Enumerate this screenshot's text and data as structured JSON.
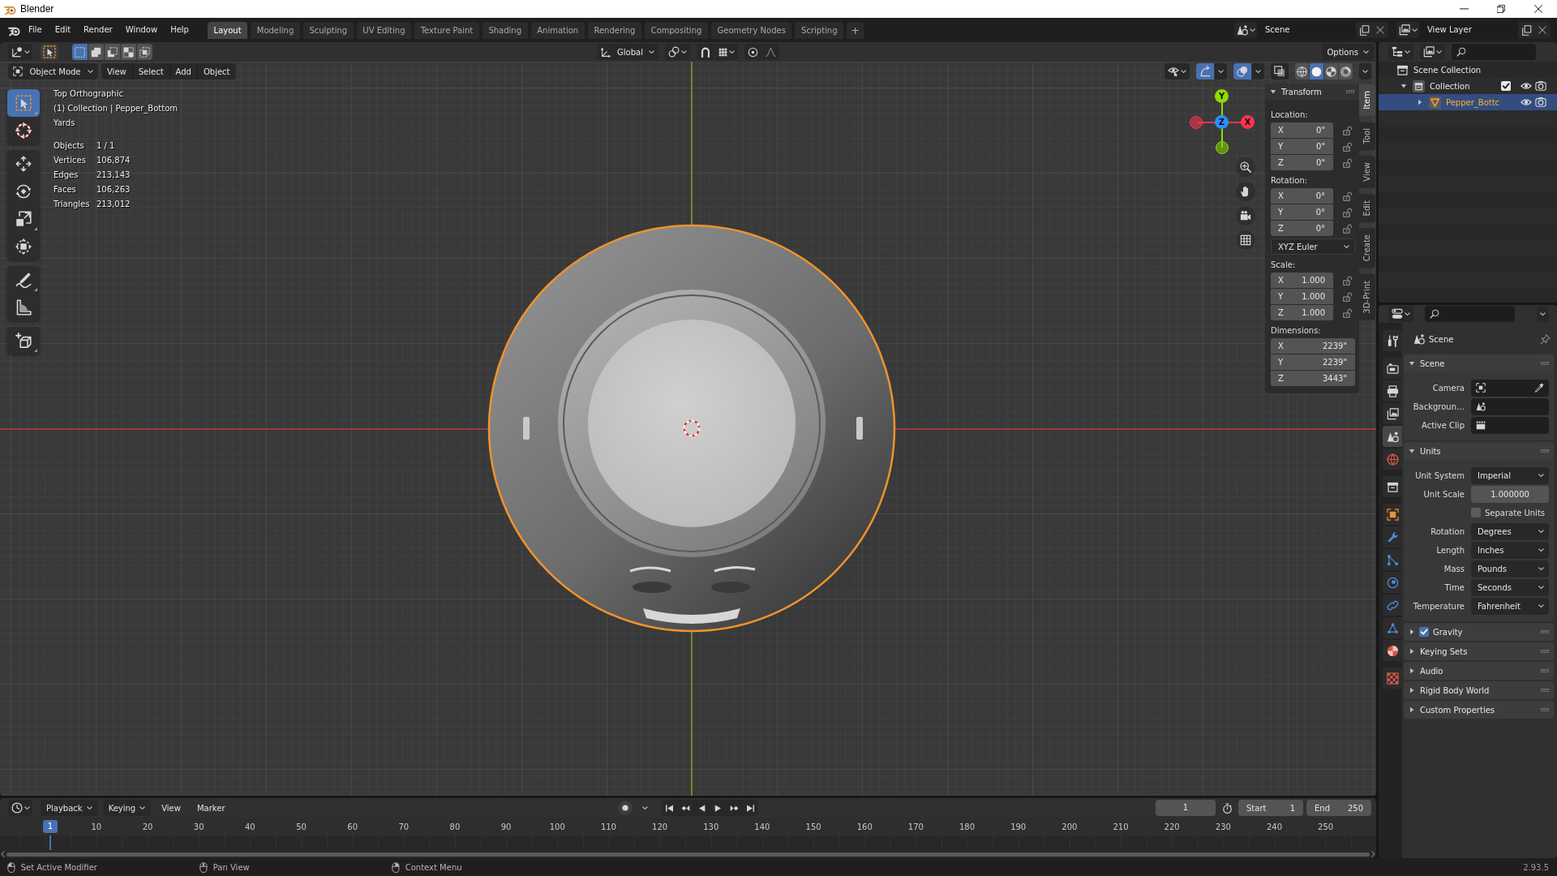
{
  "window": {
    "title": "Blender"
  },
  "top_bar": {
    "menus": [
      "File",
      "Edit",
      "Render",
      "Window",
      "Help"
    ],
    "workspace_tabs": [
      {
        "label": "Layout",
        "selected": true
      },
      {
        "label": "Modeling",
        "selected": false
      },
      {
        "label": "Sculpting",
        "selected": false
      },
      {
        "label": "UV Editing",
        "selected": false
      },
      {
        "label": "Texture Paint",
        "selected": false
      },
      {
        "label": "Shading",
        "selected": false
      },
      {
        "label": "Animation",
        "selected": false
      },
      {
        "label": "Rendering",
        "selected": false
      },
      {
        "label": "Compositing",
        "selected": false
      },
      {
        "label": "Geometry Nodes",
        "selected": false
      },
      {
        "label": "Scripting",
        "selected": false
      }
    ],
    "add_tab": "+",
    "scene": "Scene",
    "view_layer": "View Layer"
  },
  "viewport": {
    "tool_header": {
      "select_modes": [
        {
          "kind": "set",
          "selected": true
        },
        {
          "kind": "extend",
          "selected": false
        },
        {
          "kind": "subtract",
          "selected": false
        },
        {
          "kind": "invert",
          "selected": false
        },
        {
          "kind": "intersect",
          "selected": false
        }
      ],
      "orientation": "Global",
      "options": "Options"
    },
    "header": {
      "mode": "Object Mode",
      "menus": [
        "View",
        "Select",
        "Add",
        "Object"
      ],
      "toggles": [
        {
          "kind": "gizmos",
          "on": true
        },
        {
          "kind": "overlays",
          "on": true
        },
        {
          "kind": "xray",
          "on": false
        }
      ],
      "shading": [
        {
          "kind": "wireframe",
          "selected": false
        },
        {
          "kind": "solid",
          "selected": true
        },
        {
          "kind": "material",
          "selected": false
        },
        {
          "kind": "rendered",
          "selected": false
        }
      ]
    },
    "tool_groups": [
      {
        "tools": [
          {
            "kind": "select_box",
            "selected": true,
            "expandable": true
          },
          {
            "kind": "cursor",
            "selected": false,
            "expandable": false
          }
        ]
      },
      {
        "tools": [
          {
            "kind": "move",
            "selected": false,
            "expandable": false
          },
          {
            "kind": "rotate",
            "selected": false,
            "expandable": false
          },
          {
            "kind": "scale",
            "selected": false,
            "expandable": true
          },
          {
            "kind": "transform",
            "selected": false,
            "expandable": false
          }
        ]
      },
      {
        "tools": [
          {
            "kind": "annotate",
            "selected": false,
            "expandable": true
          },
          {
            "kind": "measure",
            "selected": false,
            "expandable": false
          }
        ]
      },
      {
        "tools": [
          {
            "kind": "add_cube",
            "selected": false,
            "expandable": true
          }
        ]
      }
    ],
    "info": {
      "lines": [
        "Top Orthographic",
        "(1) Collection | Pepper_Bottom",
        "Yards"
      ],
      "stats": [
        {
          "label": "Objects",
          "value": "1 / 1"
        },
        {
          "label": "Vertices",
          "value": "106,874"
        },
        {
          "label": "Edges",
          "value": "213,143"
        },
        {
          "label": "Faces",
          "value": "106,263"
        },
        {
          "label": "Triangles",
          "value": "213,012"
        }
      ]
    },
    "gizmo_axes": [
      {
        "label": "Y",
        "color": "#8bdc00"
      },
      {
        "label": "Z",
        "color": "#2890ff"
      },
      {
        "label": "X",
        "color": "#ff3352"
      }
    ],
    "sidebar": {
      "tabs": [
        {
          "label": "Item",
          "selected": true
        },
        {
          "label": "Tool",
          "selected": false
        },
        {
          "label": "View",
          "selected": false
        },
        {
          "label": "Edit",
          "selected": false
        },
        {
          "label": "Create",
          "selected": false
        },
        {
          "label": "3D-Print",
          "selected": false
        }
      ],
      "panel": {
        "title": "Transform",
        "expanded": true,
        "groups": [
          {
            "label": "Location:",
            "fields": [
              {
                "axis": "X",
                "value": "0\"",
                "locked": false
              },
              {
                "axis": "Y",
                "value": "0\"",
                "locked": false
              },
              {
                "axis": "Z",
                "value": "0\"",
                "locked": false
              }
            ]
          },
          {
            "label": "Rotation:",
            "fields": [
              {
                "axis": "X",
                "value": "0°",
                "locked": false
              },
              {
                "axis": "Y",
                "value": "0°",
                "locked": false
              },
              {
                "axis": "Z",
                "value": "0°",
                "locked": false
              }
            ],
            "mode": "XYZ Euler"
          },
          {
            "label": "Scale:",
            "fields": [
              {
                "axis": "X",
                "value": "1.000",
                "locked": false
              },
              {
                "axis": "Y",
                "value": "1.000",
                "locked": false
              },
              {
                "axis": "Z",
                "value": "1.000",
                "locked": false
              }
            ]
          },
          {
            "label": "Dimensions:",
            "fields": [
              {
                "axis": "X",
                "value": "2239\""
              },
              {
                "axis": "Y",
                "value": "2239\""
              },
              {
                "axis": "Z",
                "value": "3443\""
              }
            ]
          }
        ]
      }
    }
  },
  "outliner": {
    "tree": [
      {
        "label": "Scene Collection",
        "kind": "scene_collection",
        "selected": false,
        "children": [
          {
            "label": "Collection",
            "kind": "collection",
            "expanded": true,
            "checked": true,
            "selected": false,
            "children": [
              {
                "label": "Pepper_Bottc",
                "kind": "mesh_object",
                "expanded": false,
                "selected": true
              }
            ]
          }
        ]
      }
    ]
  },
  "properties": {
    "tab_groups": [
      {
        "tabs": [
          {
            "kind": "tool",
            "selected": false
          }
        ]
      },
      {
        "tabs": [
          {
            "kind": "render",
            "selected": false
          },
          {
            "kind": "output",
            "selected": false
          },
          {
            "kind": "view_layer",
            "selected": false
          },
          {
            "kind": "scene",
            "selected": true
          },
          {
            "kind": "world",
            "selected": false
          }
        ]
      },
      {
        "tabs": [
          {
            "kind": "collection",
            "selected": false
          }
        ]
      },
      {
        "tabs": [
          {
            "kind": "object",
            "selected": false
          },
          {
            "kind": "modifiers",
            "selected": false
          },
          {
            "kind": "particles",
            "selected": false
          },
          {
            "kind": "physics",
            "selected": false
          },
          {
            "kind": "constraints",
            "selected": false
          },
          {
            "kind": "data",
            "selected": false
          },
          {
            "kind": "material",
            "selected": false
          }
        ]
      },
      {
        "tabs": [
          {
            "kind": "texture",
            "selected": false
          }
        ]
      }
    ],
    "context": "Scene",
    "panels": [
      {
        "title": "Scene",
        "expanded": true,
        "rows": [
          {
            "kind": "camera_picker",
            "label": "Camera"
          },
          {
            "kind": "scene_picker",
            "label": "Backgroun…"
          },
          {
            "kind": "clip_picker",
            "label": "Active Clip"
          }
        ]
      },
      {
        "title": "Units",
        "expanded": true,
        "rows": [
          {
            "kind": "dropdown",
            "label": "Unit System",
            "value": "Imperial"
          },
          {
            "kind": "number",
            "label": "Unit Scale",
            "value": "1.000000"
          },
          {
            "kind": "checkbox",
            "label": "Separate Units",
            "checked": false
          },
          {
            "kind": "dropdown",
            "label": "Rotation",
            "value": "Degrees"
          },
          {
            "kind": "dropdown",
            "label": "Length",
            "value": "Inches"
          },
          {
            "kind": "dropdown",
            "label": "Mass",
            "value": "Pounds"
          },
          {
            "kind": "dropdown",
            "label": "Time",
            "value": "Seconds"
          },
          {
            "kind": "dropdown",
            "label": "Temperature",
            "value": "Fahrenheit"
          }
        ]
      },
      {
        "title": "Gravity",
        "expanded": false,
        "checked": true
      },
      {
        "title": "Keying Sets",
        "expanded": false
      },
      {
        "title": "Audio",
        "expanded": false
      },
      {
        "title": "Rigid Body World",
        "expanded": false
      },
      {
        "title": "Custom Properties",
        "expanded": false
      }
    ]
  },
  "timeline": {
    "menus": [
      {
        "label": "Playback",
        "dropdown": true
      },
      {
        "label": "Keying",
        "dropdown": true
      },
      {
        "label": "View",
        "dropdown": false
      },
      {
        "label": "Marker",
        "dropdown": false
      }
    ],
    "current_frame": "1",
    "range": [
      {
        "label": "Start",
        "value": "1"
      },
      {
        "label": "End",
        "value": "250"
      }
    ],
    "playhead": "1",
    "ruler_labels": [
      "10",
      "20",
      "30",
      "40",
      "50",
      "60",
      "70",
      "80",
      "90",
      "100",
      "110",
      "120",
      "130",
      "140",
      "150",
      "160",
      "170",
      "180",
      "190",
      "200",
      "210",
      "220",
      "230",
      "240",
      "250"
    ]
  },
  "status_bar": {
    "hints": [
      {
        "kind": "left_click",
        "label": "Set Active Modifier"
      },
      {
        "kind": "middle_click",
        "label": "Pan View"
      },
      {
        "kind": "right_click",
        "label": "Context Menu"
      }
    ],
    "version": "2.93.5"
  }
}
